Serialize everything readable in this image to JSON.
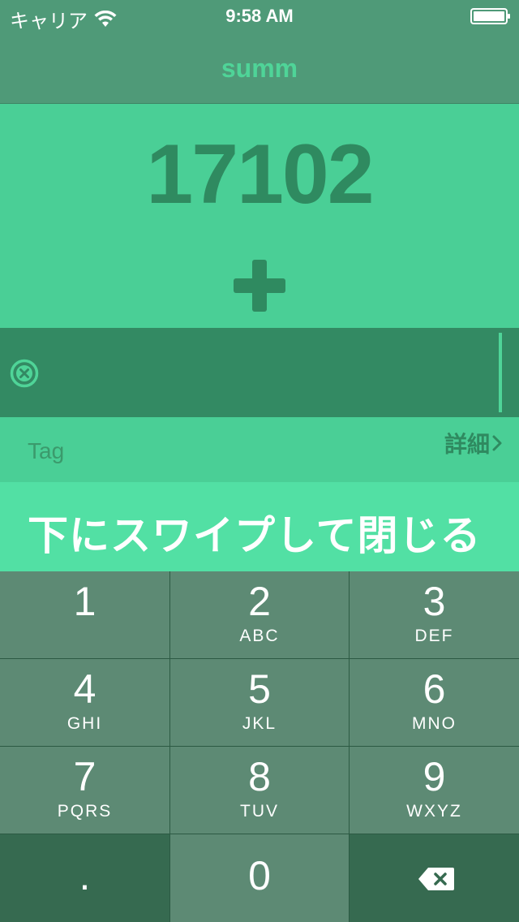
{
  "status": {
    "carrier": "キャリア",
    "time": "9:58 AM"
  },
  "nav": {
    "title": "summ"
  },
  "total": {
    "value": "17102"
  },
  "input": {
    "value": ""
  },
  "tag": {
    "placeholder": "Tag",
    "detail_label": "詳細"
  },
  "banner": {
    "text": "下にスワイプして閉じる"
  },
  "keypad": {
    "keys": [
      {
        "digit": "1",
        "letters": ""
      },
      {
        "digit": "2",
        "letters": "ABC"
      },
      {
        "digit": "3",
        "letters": "DEF"
      },
      {
        "digit": "4",
        "letters": "GHI"
      },
      {
        "digit": "5",
        "letters": "JKL"
      },
      {
        "digit": "6",
        "letters": "MNO"
      },
      {
        "digit": "7",
        "letters": "PQRS"
      },
      {
        "digit": "8",
        "letters": "TUV"
      },
      {
        "digit": "9",
        "letters": "WXYZ"
      },
      {
        "digit": ".",
        "letters": ""
      },
      {
        "digit": "0",
        "letters": ""
      }
    ]
  },
  "colors": {
    "nav_bar": "#4f9a78",
    "accent_green": "#4fd498",
    "total_text": "#2f8a60",
    "input_bar": "#338a63",
    "banner": "#52e0a4",
    "key": "#5d8a74",
    "key_dark": "#366a50"
  },
  "icons": {
    "clear": "clear-circle-icon",
    "detail": "chevron-right-icon",
    "plus": "plus-icon",
    "backspace": "backspace-icon"
  }
}
